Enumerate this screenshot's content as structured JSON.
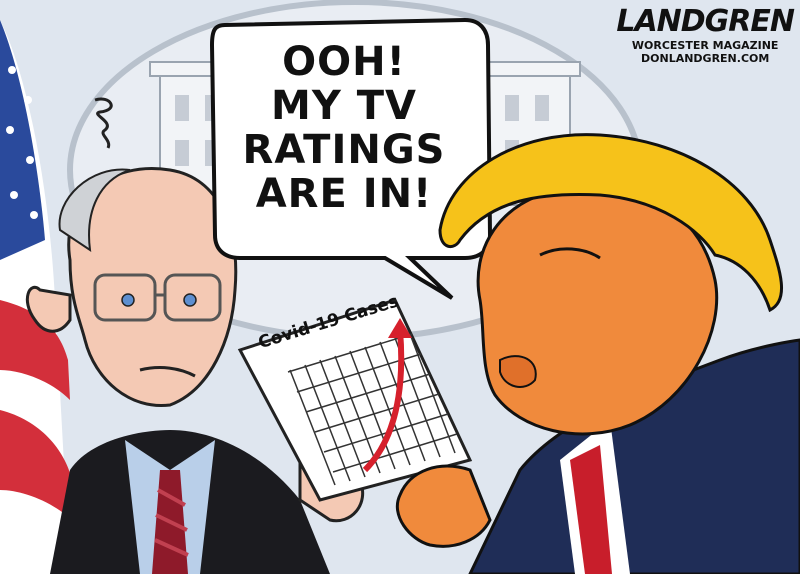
{
  "speech_bubble": {
    "lines": [
      "OOH!",
      "MY TV",
      "RATINGS",
      "ARE IN!"
    ]
  },
  "signature": {
    "name": "LANDGREN",
    "line1": "WORCESTER MAGAZINE",
    "line2": "DONLANDGREN.COM"
  },
  "paper_chart": {
    "title": "Covid-19 Cases"
  },
  "colors": {
    "sky": "#dfe6ef",
    "bubble": "#ffffff",
    "jacket": "#1f2d57",
    "tie_red": "#c81e2b",
    "orange_skin": "#f08a3c",
    "hair": "#f6c21a",
    "pale_skin": "#f4c9b4",
    "arrow": "#d6202c"
  }
}
